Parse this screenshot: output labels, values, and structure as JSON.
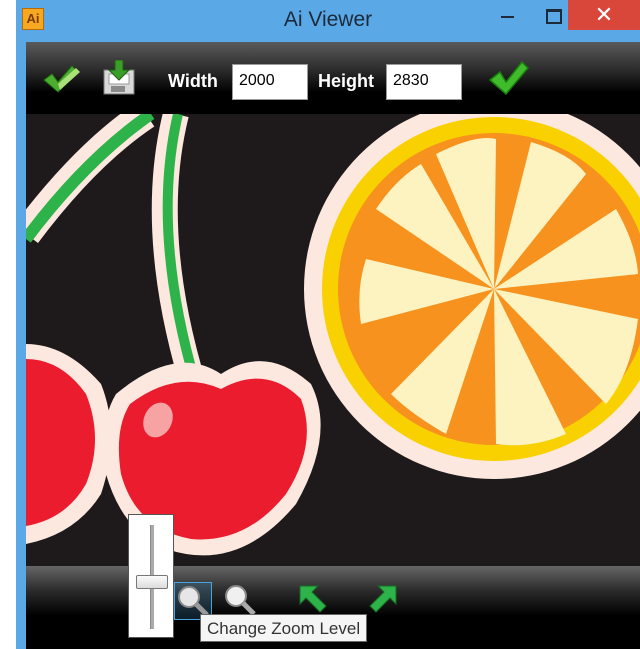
{
  "window": {
    "title": "Ai Viewer",
    "app_icon_text": "Ai",
    "close_glyph": "✕"
  },
  "toolbar": {
    "width_label": "Width",
    "width_value": "2000",
    "height_label": "Height",
    "height_value": "2830"
  },
  "zoom": {
    "tooltip": "Change Zoom Level",
    "level": 0.45
  },
  "icons": {
    "toolbar": [
      "checkmarks-icon",
      "save-download-icon",
      "apply-check-icon"
    ],
    "bottombar": [
      "zoom-in-icon",
      "zoom-out-icon",
      "arrow-expand-icon",
      "arrow-expand-icon"
    ]
  },
  "colors": {
    "titlebar": "#5aa9e6",
    "close": "#d9473b",
    "cherry": "#ea1c2d",
    "orange": "#f7921e",
    "stem": "#2db34a",
    "background_art": "#1e1a1b"
  }
}
